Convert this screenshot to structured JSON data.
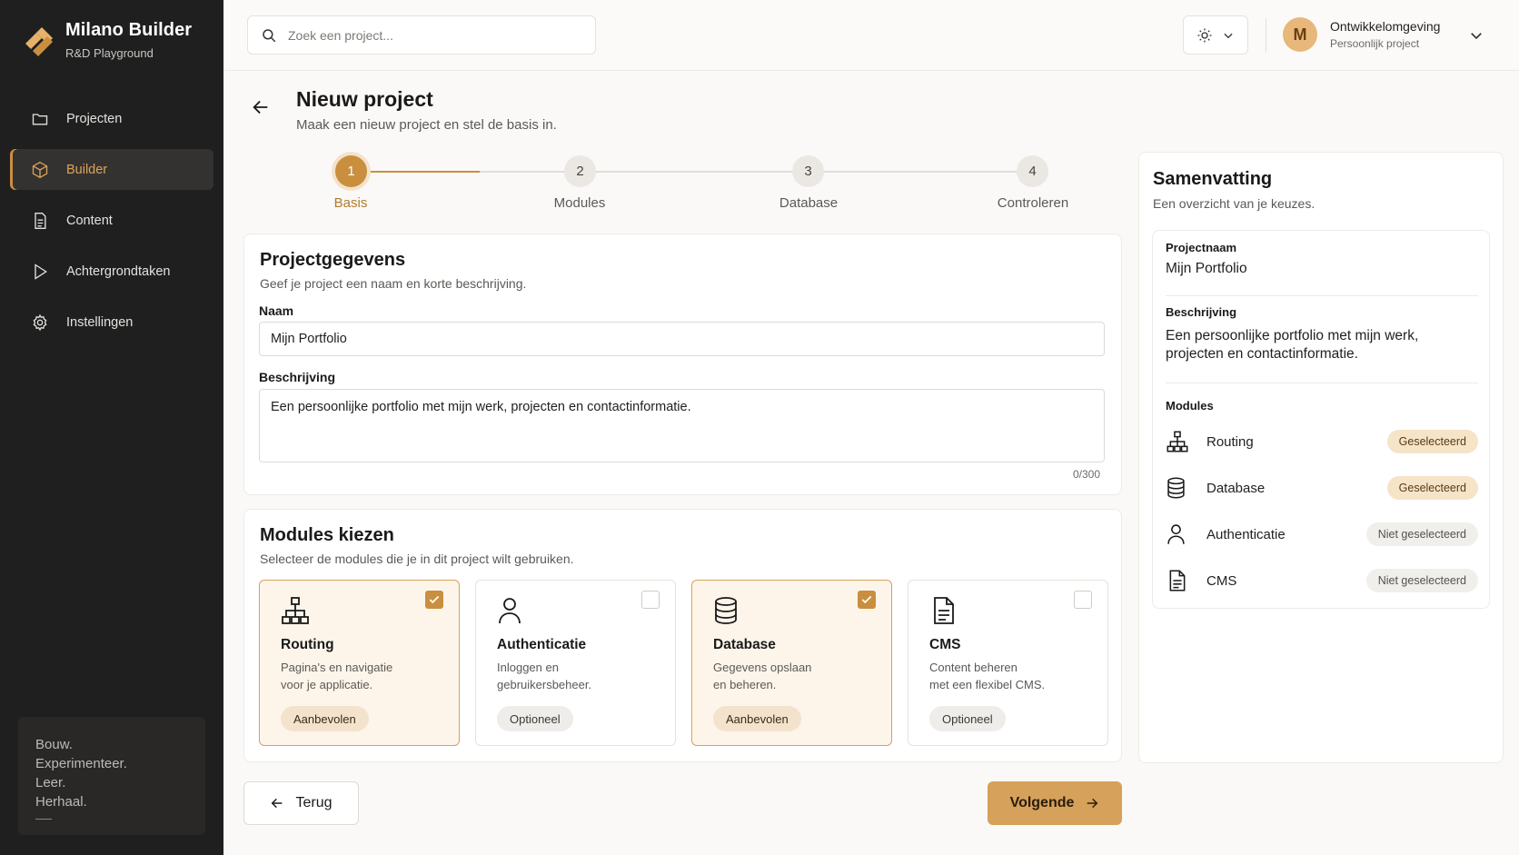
{
  "brand": {
    "title": "Milano Builder",
    "subtitle": "R&D Playground"
  },
  "nav": [
    {
      "label": "Projecten",
      "icon": "folder-icon"
    },
    {
      "label": "Builder",
      "icon": "cube-icon",
      "active": true
    },
    {
      "label": "Content",
      "icon": "document-icon"
    },
    {
      "label": "Achtergrondtaken",
      "icon": "play-icon"
    },
    {
      "label": "Instellingen",
      "icon": "gear-icon"
    }
  ],
  "motto": {
    "lines": [
      "Bouw.",
      "Experimenteer.",
      "Leer.",
      "Herhaal."
    ]
  },
  "topbar": {
    "search_placeholder": "Zoek een project...",
    "user": {
      "initial": "M",
      "name": "Ontwikkelomgeving",
      "sub": "Persoonlijk project"
    }
  },
  "page": {
    "title": "Nieuw project",
    "subtitle": "Maak een nieuw project en stel de basis in."
  },
  "stepper": {
    "steps": [
      {
        "number": "1",
        "label": "Basis",
        "active": true
      },
      {
        "number": "2",
        "label": "Modules"
      },
      {
        "number": "3",
        "label": "Database"
      },
      {
        "number": "4",
        "label": "Controleren"
      }
    ],
    "progress_in_first_segment": 0.5
  },
  "details": {
    "title": "Projectgegevens",
    "subtitle": "Geef je project een naam en korte beschrijving.",
    "name_label": "Naam",
    "name_value": "Mijn Portfolio",
    "desc_label": "Beschrijving",
    "desc_value": "Een persoonlijke portfolio met mijn werk, projecten en contactinformatie.",
    "counter": "0/300"
  },
  "modules": {
    "title": "Modules kiezen",
    "subtitle": "Selecteer de modules die je in dit project wilt gebruiken.",
    "items": [
      {
        "name": "Routing",
        "desc_line1": "Pagina's en navigatie",
        "desc_line2": "voor je applicatie.",
        "tag": "Aanbevolen",
        "selected": true,
        "icon": "sitemap-icon"
      },
      {
        "name": "Authenticatie",
        "desc_line1": "Inloggen en",
        "desc_line2": "gebruikersbeheer.",
        "tag": "Optioneel",
        "selected": false,
        "icon": "user-icon"
      },
      {
        "name": "Database",
        "desc_line1": "Gegevens opslaan",
        "desc_line2": "en beheren.",
        "tag": "Aanbevolen",
        "selected": true,
        "icon": "database-icon"
      },
      {
        "name": "CMS",
        "desc_line1": "Content beheren",
        "desc_line2": "met een flexibel CMS.",
        "tag": "Optioneel",
        "selected": false,
        "icon": "document-icon"
      }
    ]
  },
  "actions": {
    "back": "Terug",
    "next": "Volgende"
  },
  "summary": {
    "title": "Samenvatting",
    "subtitle": "Een overzicht van je keuzes.",
    "project_label": "Projectnaam",
    "project_value": "Mijn Portfolio",
    "desc_label": "Beschrijving",
    "desc_line1": "Een persoonlijke portfolio met mijn werk,",
    "desc_line2": "projecten en contactinformatie.",
    "modules_label": "Modules",
    "modules": [
      {
        "name": "Routing",
        "status": "Geselecteerd",
        "selected": true
      },
      {
        "name": "Database",
        "status": "Geselecteerd",
        "selected": true
      },
      {
        "name": "Authenticatie",
        "status": "Niet geselecteerd",
        "selected": false
      },
      {
        "name": "CMS",
        "status": "Niet geselecteerd",
        "selected": false
      }
    ]
  },
  "colors": {
    "accent": "#c98f3f",
    "sidebar": "#1f1f1f",
    "accent_light": "#f3e3cc"
  }
}
